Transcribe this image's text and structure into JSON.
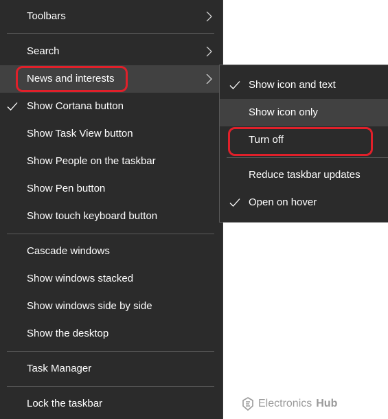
{
  "main_menu": {
    "items": [
      {
        "label": "Toolbars",
        "checked": false,
        "submenu": true
      },
      {
        "label": "Search",
        "checked": false,
        "submenu": true
      },
      {
        "label": "News and interests",
        "checked": false,
        "submenu": true
      },
      {
        "label": "Show Cortana button",
        "checked": true,
        "submenu": false
      },
      {
        "label": "Show Task View button",
        "checked": false,
        "submenu": false
      },
      {
        "label": "Show People on the taskbar",
        "checked": false,
        "submenu": false
      },
      {
        "label": "Show Pen button",
        "checked": false,
        "submenu": false
      },
      {
        "label": "Show touch keyboard button",
        "checked": false,
        "submenu": false
      },
      {
        "label": "Cascade windows",
        "checked": false,
        "submenu": false
      },
      {
        "label": "Show windows stacked",
        "checked": false,
        "submenu": false
      },
      {
        "label": "Show windows side by side",
        "checked": false,
        "submenu": false
      },
      {
        "label": "Show the desktop",
        "checked": false,
        "submenu": false
      },
      {
        "label": "Task Manager",
        "checked": false,
        "submenu": false
      },
      {
        "label": "Lock the taskbar",
        "checked": false,
        "submenu": false
      }
    ]
  },
  "submenu": {
    "items": [
      {
        "label": "Show icon and text",
        "checked": true
      },
      {
        "label": "Show icon only",
        "checked": false
      },
      {
        "label": "Turn off",
        "checked": false
      },
      {
        "label": "Reduce taskbar updates",
        "checked": false
      },
      {
        "label": "Open on hover",
        "checked": true
      }
    ]
  },
  "watermark": {
    "text_a": "Electronics",
    "text_b": "Hub"
  },
  "colors": {
    "menu_background": "#2b2b2b",
    "hover_background": "#414141",
    "text": "#ffffff",
    "annotation": "#e0202a"
  }
}
